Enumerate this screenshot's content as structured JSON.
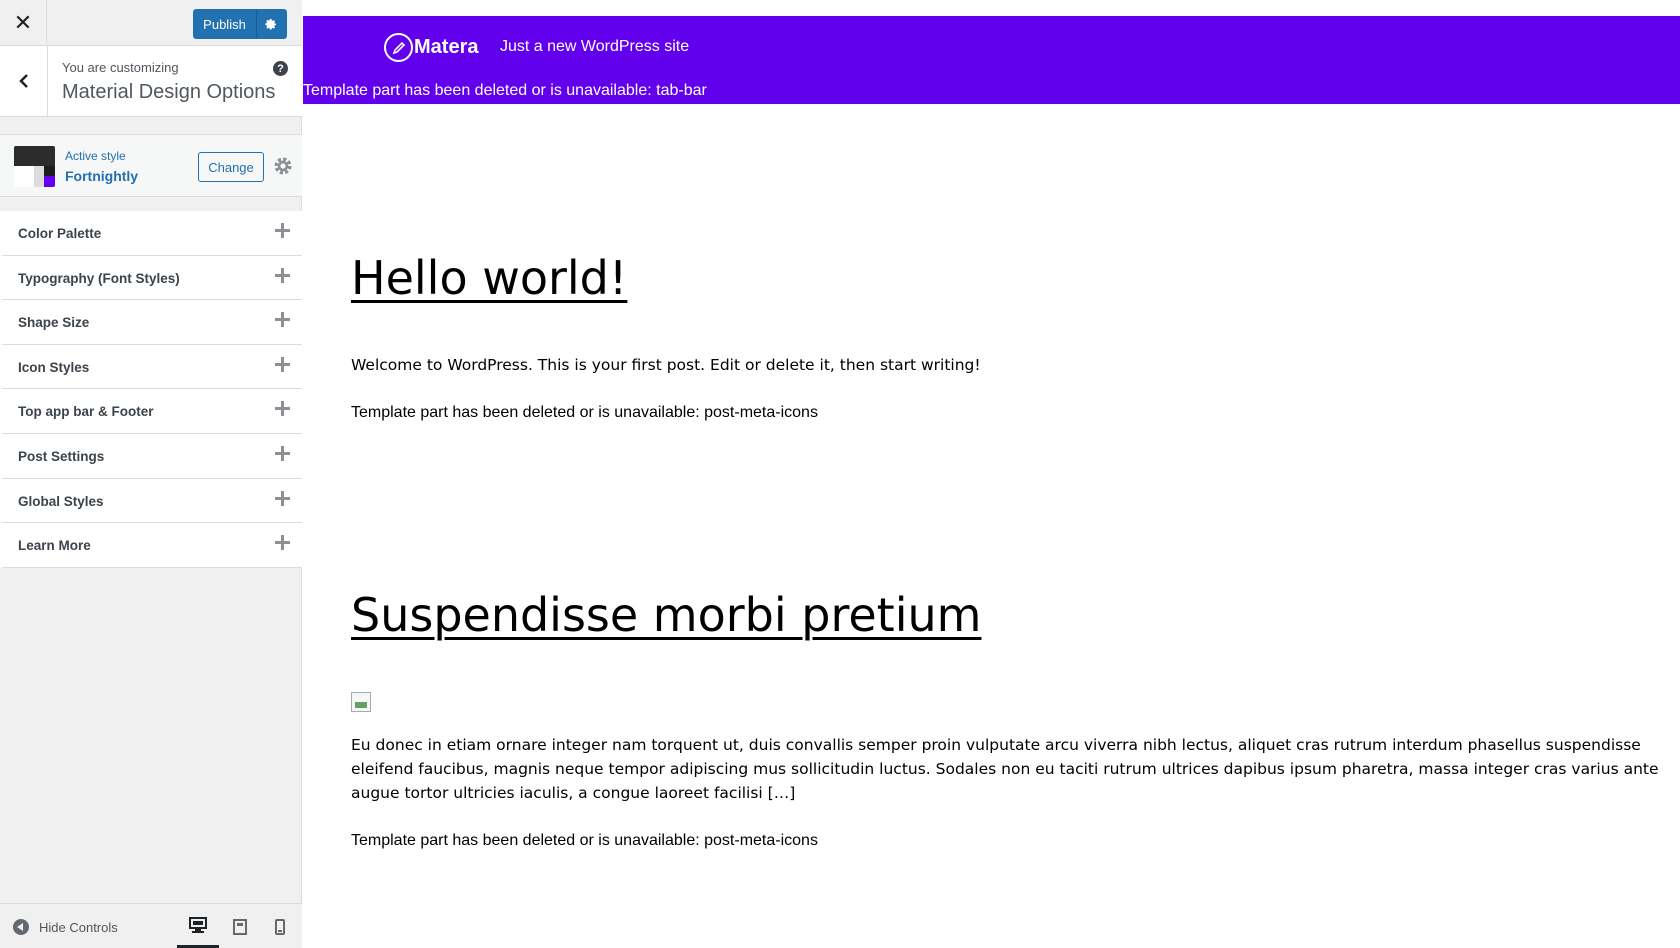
{
  "sidebar": {
    "close_icon": "close-icon",
    "publish_label": "Publish",
    "customizing_label": "You are customizing",
    "panel_title": "Material Design Options",
    "help_glyph": "?",
    "active_style_label": "Active style",
    "active_style_name": "Fortnightly",
    "change_label": "Change",
    "sections": [
      "Color Palette",
      "Typography (Font Styles)",
      "Shape Size",
      "Icon Styles",
      "Top app bar & Footer",
      "Post Settings",
      "Global Styles",
      "Learn More"
    ],
    "hide_controls_label": "Hide Controls",
    "accent_color": "#2271b1"
  },
  "preview": {
    "site_name": "Matera",
    "site_tagline": "Just a new WordPress site",
    "tabbar_notice": "Template part has been deleted or is unavailable: tab-bar",
    "header_color": "#6200ee",
    "posts": [
      {
        "title": "Hello world!",
        "excerpt": "Welcome to WordPress. This is your first post. Edit or delete it, then start writing!",
        "meta_notice": "Template part has been deleted or is unavailable: post-meta-icons"
      },
      {
        "title": "Suspendisse morbi pretium",
        "excerpt": "Eu donec in etiam ornare integer nam torquent ut, duis convallis semper proin vulputate arcu viverra nibh lectus, aliquet cras rutrum interdum phasellus suspendisse eleifend faucibus, magnis neque tempor adipiscing mus sollicitudin luctus. Sodales non eu taciti rutrum ultrices dapibus ipsum pharetra, massa integer cras varius ante augue tortor ultricies iaculis, a congue laoreet facilisi […]",
        "meta_notice": "Template part has been deleted or is unavailable: post-meta-icons"
      }
    ]
  }
}
